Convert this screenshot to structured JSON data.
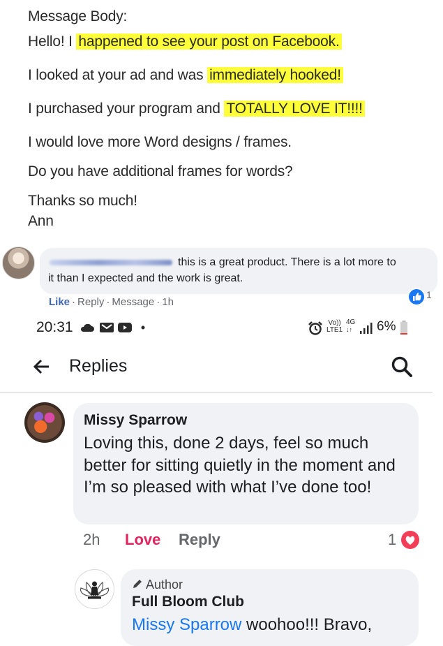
{
  "email": {
    "label": "Message Body:",
    "line1_a": "Hello! I ",
    "line1_hl": "happened to see your post on Facebook.",
    "line2_a": "I looked at your ad and was ",
    "line2_hl": "immediately hooked!",
    "line3_a": "I purchased your program and ",
    "line3_hl": "TOTALLY LOVE IT!!!!",
    "line4": "I would love more Word designs / frames.",
    "line5": "Do you have additional frames for words?",
    "line6": "Thanks so much!",
    "line7": "Ann",
    "highlight_color": "#ffff3a"
  },
  "fb_comment": {
    "text_line1": "this is a great product. There is a lot more to",
    "text_line2": "it than I expected and the work is great.",
    "actions": {
      "like": "Like",
      "reply": "Reply",
      "message": "Message",
      "time": "1h"
    },
    "like_count": "1",
    "accent_color": "#4267b2"
  },
  "status_bar": {
    "time": "20:31",
    "network_volte": "Vo))",
    "network_lte": "LTE1",
    "network_4g": "4G",
    "battery": "6%",
    "icons": [
      "cloud-icon",
      "gmail-icon",
      "youtube-icon",
      "dot-icon",
      "alarm-icon",
      "signal-icon",
      "battery-icon"
    ]
  },
  "header": {
    "title": "Replies"
  },
  "reply_missy": {
    "author": "Missy Sparrow",
    "text": "Loving this, done 2 days, feel so much better for sitting quietly in the moment and I’m so pleased with what I’ve done too!",
    "time": "2h",
    "love_label": "Love",
    "reply_label": "Reply",
    "reaction_count": "1",
    "love_color": "#e0245e"
  },
  "reply_author": {
    "badge": "Author",
    "name": "Full Bloom Club",
    "mention": "Missy Sparrow",
    "text": " woohoo!!! Bravo,"
  }
}
